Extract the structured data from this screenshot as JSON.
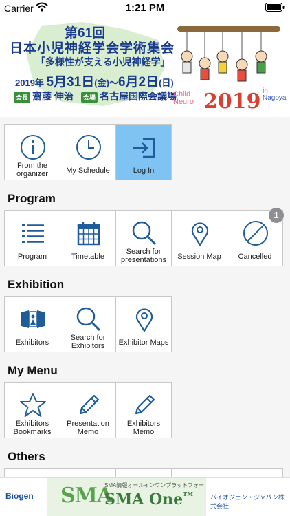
{
  "status_bar": {
    "carrier": "Carrier",
    "time": "1:21 PM"
  },
  "banner": {
    "line1": "第61回",
    "line2": "日本小児神経学会学術集会",
    "line3": "「多様性が支える小児神経学」",
    "year_prefix": "2019年",
    "date_start": "5月31日",
    "dow_start": "(金)",
    "tilde": "〜",
    "date_end": "6月2日",
    "dow_end": "(日)",
    "chair_tag": "会長",
    "chair_name": "齋藤 伸治",
    "venue_tag": "会場",
    "venue_name": "名古屋国際会議場",
    "art_child": "Child",
    "art_neuro": "Neuro",
    "art_year": "2019",
    "art_in": "in",
    "art_city": "Nagoya"
  },
  "top_tiles": [
    {
      "label": "From the organizer",
      "icon": "info-icon"
    },
    {
      "label": "My Schedule",
      "icon": "clock-icon"
    },
    {
      "label": "Log In",
      "icon": "login-icon",
      "selected": true
    }
  ],
  "sections": {
    "program": {
      "title": "Program",
      "tiles": [
        {
          "label": "Program",
          "icon": "list-icon"
        },
        {
          "label": "Timetable",
          "icon": "calendar-icon"
        },
        {
          "label": "Search for presentations",
          "icon": "search-icon"
        },
        {
          "label": "Session Map",
          "icon": "map-pin-icon"
        },
        {
          "label": "Cancelled",
          "icon": "prohibited-icon",
          "badge": "1"
        }
      ]
    },
    "exhibition": {
      "title": "Exhibition",
      "tiles": [
        {
          "label": "Exhibitors",
          "icon": "exhibitor-booth-icon"
        },
        {
          "label": "Search for Exhibitors",
          "icon": "search-icon"
        },
        {
          "label": "Exhibitor Maps",
          "icon": "map-pin-icon"
        }
      ]
    },
    "my_menu": {
      "title": "My Menu",
      "tiles": [
        {
          "label": "Exhibitors Bookmarks",
          "icon": "star-icon"
        },
        {
          "label": "Presentation Memo",
          "icon": "pencil-icon"
        },
        {
          "label": "Exhibitors Memo",
          "icon": "pencil-icon"
        }
      ]
    },
    "others": {
      "title": "Others"
    }
  },
  "ad": {
    "left": "Biogen",
    "logo": "SMA",
    "subtitle": "SMA情報オールインワンプラットフォーム",
    "title": "SMA One",
    "tm": "TM",
    "right": "バイオジェン・ジャパン株式会社"
  },
  "colors": {
    "accent": "#1f5c99",
    "selected_tile": "#7ec3f2",
    "banner_text": "#1a3a8c"
  }
}
